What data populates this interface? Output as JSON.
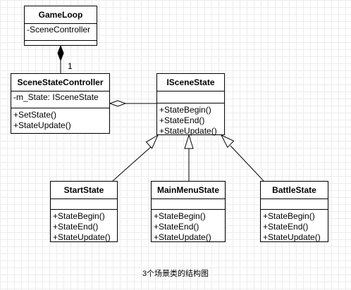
{
  "diagram": {
    "classes": {
      "gameloop": {
        "name": "GameLoop",
        "attributes": [
          "-SceneController"
        ],
        "operations": []
      },
      "scenestatecontroller": {
        "name": "SceneStateController",
        "attributes": [
          "-m_State: ISceneState"
        ],
        "operations": [
          "+SetState()",
          "+StateUpdate()"
        ]
      },
      "iscenestate": {
        "name": "ISceneState",
        "attributes": [],
        "operations": [
          "+StateBegin()",
          "+StateEnd()",
          "+StateUpdate()"
        ]
      },
      "startstate": {
        "name": "StartState",
        "attributes": [],
        "operations": [
          "+StateBegin()",
          "+StateEnd()",
          "+StateUpdate()"
        ]
      },
      "mainmenustate": {
        "name": "MainMenuState",
        "attributes": [],
        "operations": [
          "+StateBegin()",
          "+StateEnd()",
          "+StateUpdate()"
        ]
      },
      "battlestate": {
        "name": "BattleState",
        "attributes": [],
        "operations": [
          "+StateBegin()",
          "+StateEnd()",
          "+StateUpdate()"
        ]
      }
    },
    "multiplicity": "1",
    "caption": "3个场景类的结构图"
  }
}
